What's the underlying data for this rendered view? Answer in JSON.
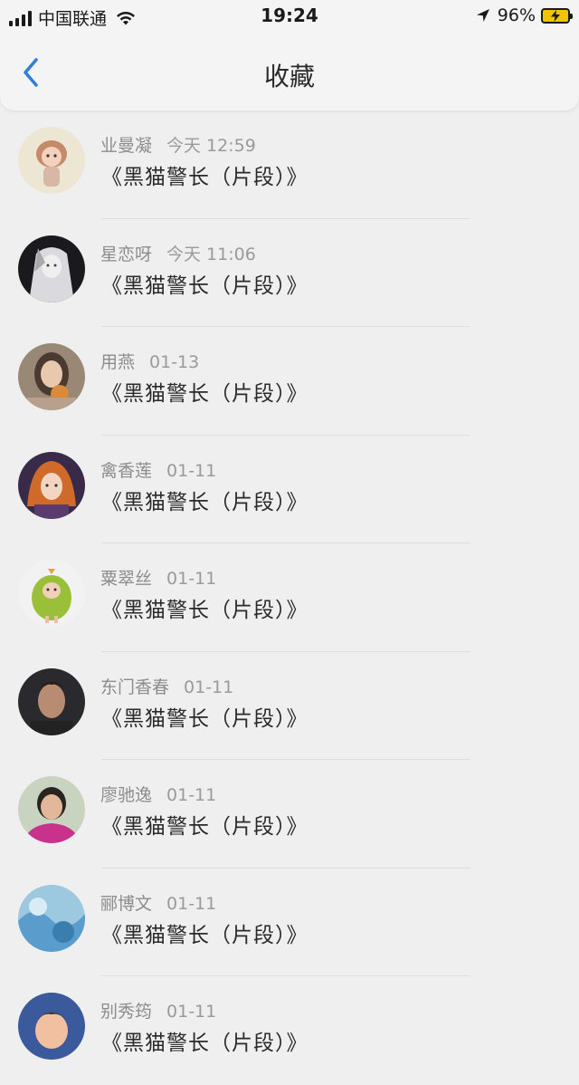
{
  "status_bar": {
    "carrier": "中国联通",
    "time": "19:24",
    "battery": "96%"
  },
  "nav": {
    "title": "收藏",
    "back_icon": "chevron-left-icon"
  },
  "accent_color": "#2f7fd8",
  "items": [
    {
      "name": "业曼凝",
      "time": "今天 12:59",
      "title": "《黑猫警长（片段）》"
    },
    {
      "name": "星恋呀",
      "time": "今天 11:06",
      "title": "《黑猫警长（片段）》"
    },
    {
      "name": "用燕",
      "time": "01-13",
      "title": "《黑猫警长（片段）》"
    },
    {
      "name": "禽香莲",
      "time": "01-11",
      "title": "《黑猫警长（片段）》"
    },
    {
      "name": "粟翠丝",
      "time": "01-11",
      "title": "《黑猫警长（片段）》"
    },
    {
      "name": "东门香春",
      "time": "01-11",
      "title": "《黑猫警长（片段）》"
    },
    {
      "name": "廖驰逸",
      "time": "01-11",
      "title": "《黑猫警长（片段）》"
    },
    {
      "name": "郦博文",
      "time": "01-11",
      "title": "《黑猫警长（片段）》"
    },
    {
      "name": "别秀筠",
      "time": "01-11",
      "title": "《黑猫警长（片段）》"
    }
  ]
}
